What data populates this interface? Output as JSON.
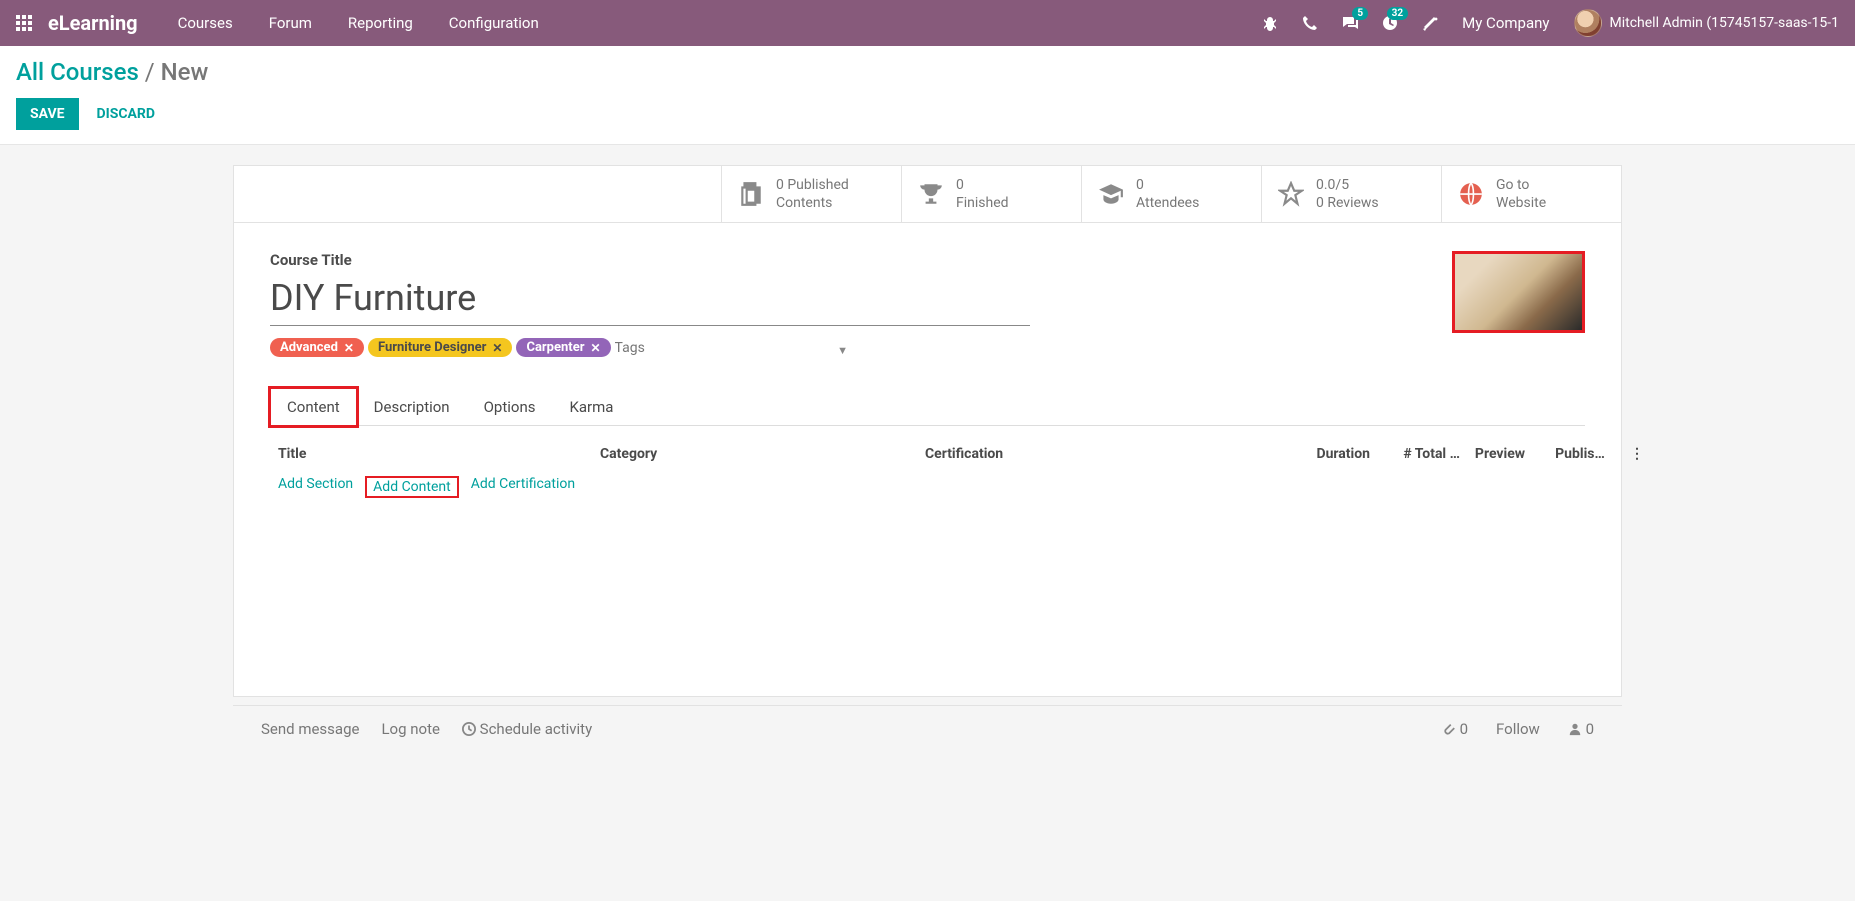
{
  "header": {
    "brand": "eLearning",
    "nav": [
      "Courses",
      "Forum",
      "Reporting",
      "Configuration"
    ],
    "msg_badge": "5",
    "activity_badge": "32",
    "company": "My Company",
    "user": "Mitchell Admin (15745157-saas-15-1"
  },
  "breadcrumb": {
    "parent": "All Courses",
    "sep": " / ",
    "current": "New"
  },
  "actions": {
    "save": "SAVE",
    "discard": "DISCARD"
  },
  "stats": {
    "contents": {
      "line1": "0 Published",
      "line2": "Contents"
    },
    "finished": {
      "line1": "0",
      "line2": "Finished"
    },
    "attendees": {
      "line1": "0",
      "line2": "Attendees"
    },
    "reviews": {
      "line1": "0.0/5",
      "line2": "0 Reviews"
    },
    "website": {
      "line1": "Go to",
      "line2": "Website"
    }
  },
  "form": {
    "title_label": "Course Title",
    "title": "DIY Furniture",
    "tags": {
      "t1": "Advanced",
      "t2": "Furniture Designer",
      "t3": "Carpenter"
    },
    "tags_placeholder": "Tags"
  },
  "tabs": {
    "t1": "Content",
    "t2": "Description",
    "t3": "Options",
    "t4": "Karma"
  },
  "columns": {
    "title": "Title",
    "category": "Category",
    "cert": "Certification",
    "duration": "Duration",
    "total": "# Total …",
    "preview": "Preview",
    "publish": "Publis…"
  },
  "add_actions": {
    "section": "Add Section",
    "content": "Add Content",
    "cert": "Add Certification"
  },
  "chatter": {
    "send": "Send message",
    "log": "Log note",
    "schedule": "Schedule activity",
    "attachments": "0",
    "follow": "Follow",
    "followers": "0"
  }
}
